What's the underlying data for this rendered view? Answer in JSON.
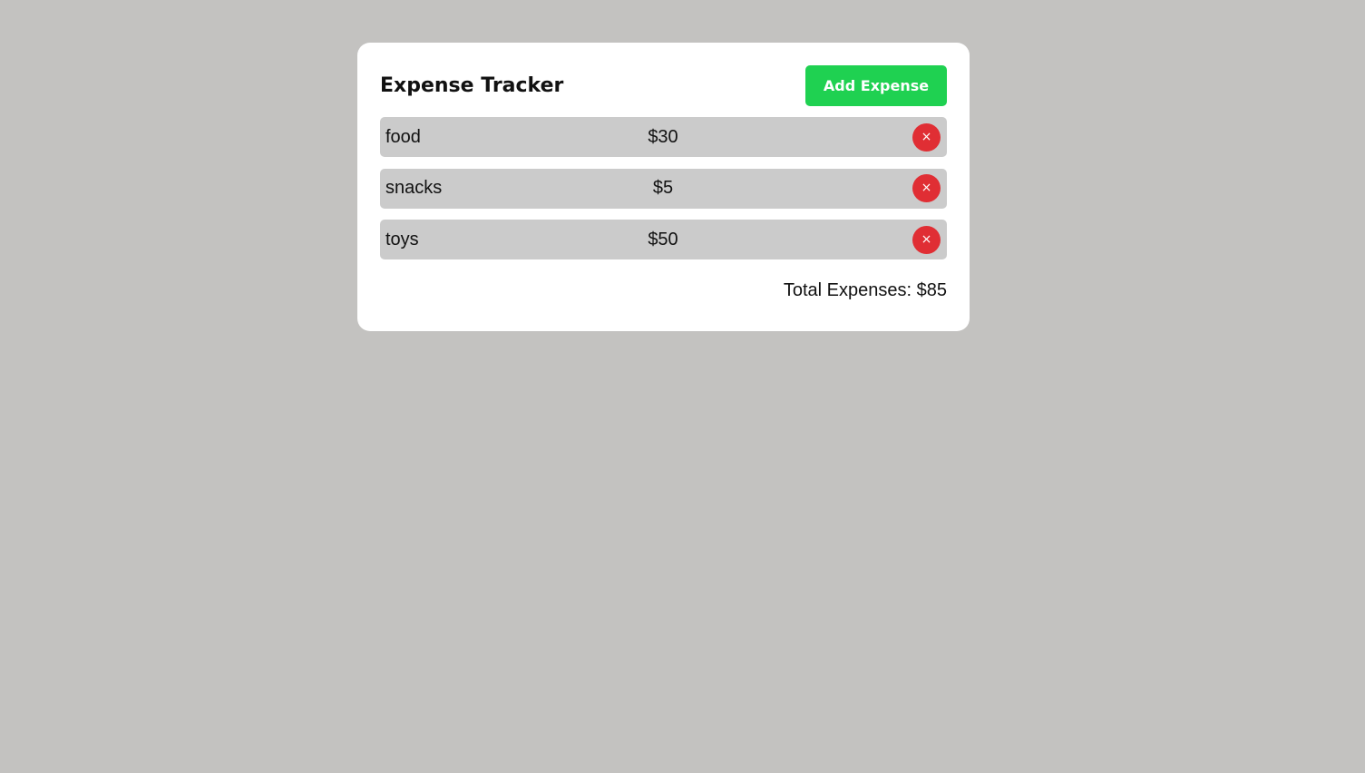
{
  "app": {
    "title": "Expense Tracker",
    "add_button_label": "Add Expense"
  },
  "expenses": [
    {
      "name": "food",
      "amount": "$30",
      "delete_label": "×"
    },
    {
      "name": "snacks",
      "amount": "$5",
      "delete_label": "×"
    },
    {
      "name": "toys",
      "amount": "$50",
      "delete_label": "×"
    }
  ],
  "summary": {
    "total_text": "Total Expenses: $85"
  },
  "colors": {
    "background": "#c3c2c0",
    "card": "#ffffff",
    "add_button": "#1fd151",
    "row": "#cbcbcb",
    "delete_button": "#e02e34"
  },
  "icons": {
    "delete": "close-icon"
  }
}
